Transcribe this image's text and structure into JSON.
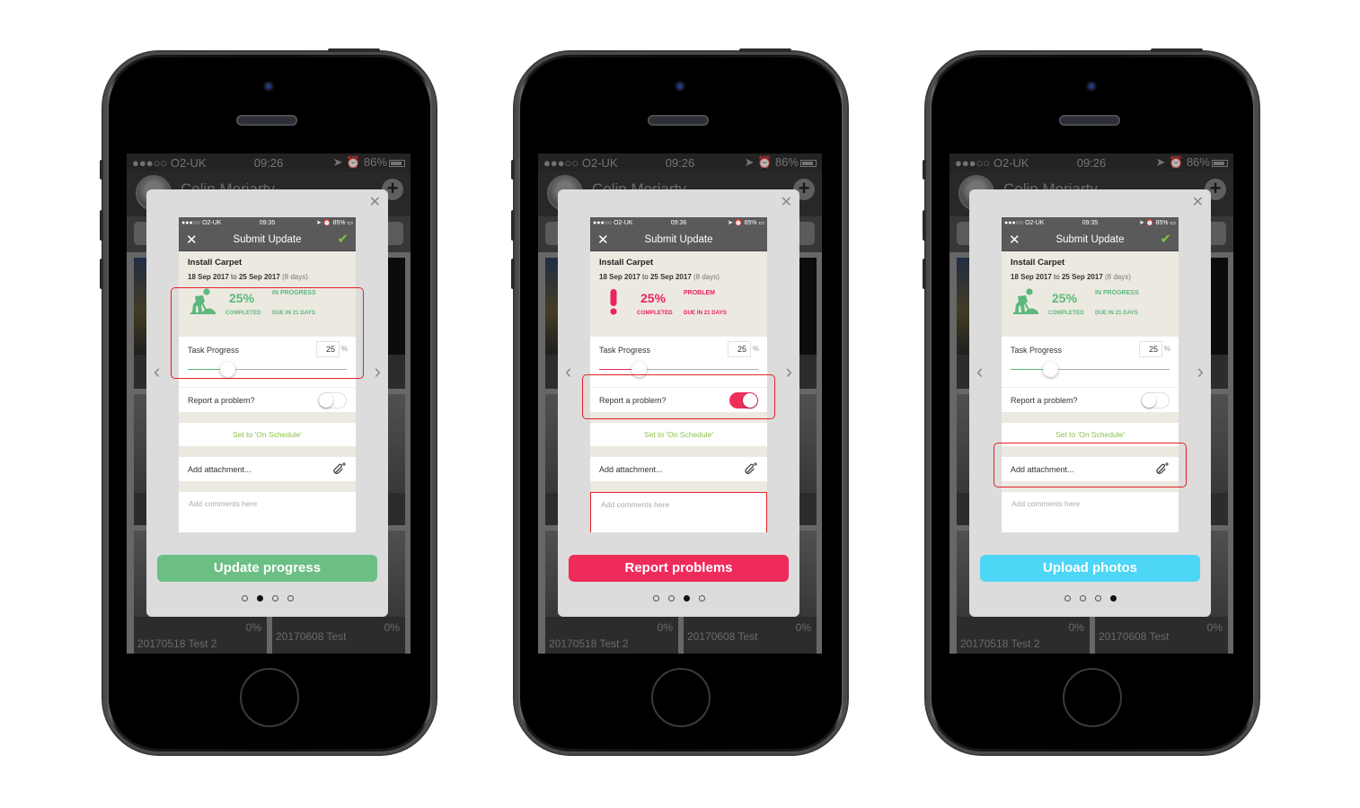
{
  "phones": [
    {
      "bg_status": {
        "carrier": "●●●○○ O2-UK",
        "time": "09:26",
        "battery": "86%"
      },
      "bg_user": "Colin Moriarty",
      "bg_tiles": [
        {
          "title": "20170518 Test 2",
          "percent": "0%"
        },
        {
          "title": "20170608 Test",
          "percent": "0%"
        }
      ],
      "mini_status": {
        "carrier": "●●●○○ O2-UK",
        "time": "09:35",
        "battery": "85%"
      },
      "nav_title": "Submit Update",
      "show_check": true,
      "task_name": "Install Carpet",
      "date_from": "18 Sep 2017",
      "date_to_word": "to",
      "date_to": "25 Sep 2017",
      "duration": "(8 days)",
      "status_icon": "worker-icon",
      "percent": "25%",
      "percent_label": "COMPLETED",
      "state": "IN PROGRESS",
      "due": "DUE IN 21 DAYS",
      "accent": "#5cb87c",
      "progress_label": "Task Progress",
      "progress_value": "25",
      "progress_fraction": 0.25,
      "progress_unit": "%",
      "problem_label": "Report a problem?",
      "problem_on": false,
      "schedule_link": "Set to 'On Schedule'",
      "attachment_label": "Add attachment...",
      "comments_placeholder": "Add comments here",
      "cta_label": "Update progress",
      "cta_color": "#6cbf84",
      "page_index": 1,
      "page_count": 4,
      "highlight": "progress"
    },
    {
      "bg_status": {
        "carrier": "●●●○○ O2-UK",
        "time": "09:26",
        "battery": "86%"
      },
      "bg_user": "Colin Moriarty",
      "bg_tiles": [
        {
          "title": "20170518 Test 2",
          "percent": "0%"
        },
        {
          "title": "20170608 Test",
          "percent": "0%"
        }
      ],
      "mini_status": {
        "carrier": "●●●○○ O2-UK",
        "time": "09:36",
        "battery": "85%"
      },
      "nav_title": "Submit Update",
      "show_check": false,
      "task_name": "Install Carpet",
      "date_from": "18 Sep 2017",
      "date_to_word": "to",
      "date_to": "25 Sep 2017",
      "duration": "(8 days)",
      "status_icon": "exclamation-icon",
      "percent": "25%",
      "percent_label": "COMPLETED",
      "state": "PROBLEM",
      "due": "DUE IN 21 DAYS",
      "accent": "#e8245a",
      "progress_label": "Task Progress",
      "progress_value": "25",
      "progress_fraction": 0.25,
      "progress_unit": "%",
      "problem_label": "Report a problem?",
      "problem_on": true,
      "schedule_link": "Set to 'On Schedule'",
      "attachment_label": "Add attachment...",
      "comments_placeholder": "Add comments here",
      "cta_label": "Report problems",
      "cta_color": "#ef2b5b",
      "page_index": 2,
      "page_count": 4,
      "highlight": "problem"
    },
    {
      "bg_status": {
        "carrier": "●●●○○ O2-UK",
        "time": "09:26",
        "battery": "86%"
      },
      "bg_user": "Colin Moriarty",
      "bg_tiles": [
        {
          "title": "20170518 Test 2",
          "percent": "0%"
        },
        {
          "title": "20170608 Test",
          "percent": "0%"
        }
      ],
      "mini_status": {
        "carrier": "●●●○○ O2-UK",
        "time": "09:35",
        "battery": "85%"
      },
      "nav_title": "Submit Update",
      "show_check": true,
      "task_name": "Install Carpet",
      "date_from": "18 Sep 2017",
      "date_to_word": "to",
      "date_to": "25 Sep 2017",
      "duration": "(8 days)",
      "status_icon": "worker-icon",
      "percent": "25%",
      "percent_label": "COMPLETED",
      "state": "IN PROGRESS",
      "due": "DUE IN 21 DAYS",
      "accent": "#5cb87c",
      "progress_label": "Task Progress",
      "progress_value": "25",
      "progress_fraction": 0.25,
      "progress_unit": "%",
      "problem_label": "Report a problem?",
      "problem_on": false,
      "schedule_link": "Set to 'On Schedule'",
      "attachment_label": "Add attachment...",
      "comments_placeholder": "Add comments here",
      "cta_label": "Upload photos",
      "cta_color": "#4dd6f5",
      "page_index": 3,
      "page_count": 4,
      "highlight": "attachment"
    }
  ],
  "icons": {
    "close": "✕",
    "check": "✔",
    "chevron_left": "‹",
    "chevron_right": "›",
    "plus": "+"
  }
}
